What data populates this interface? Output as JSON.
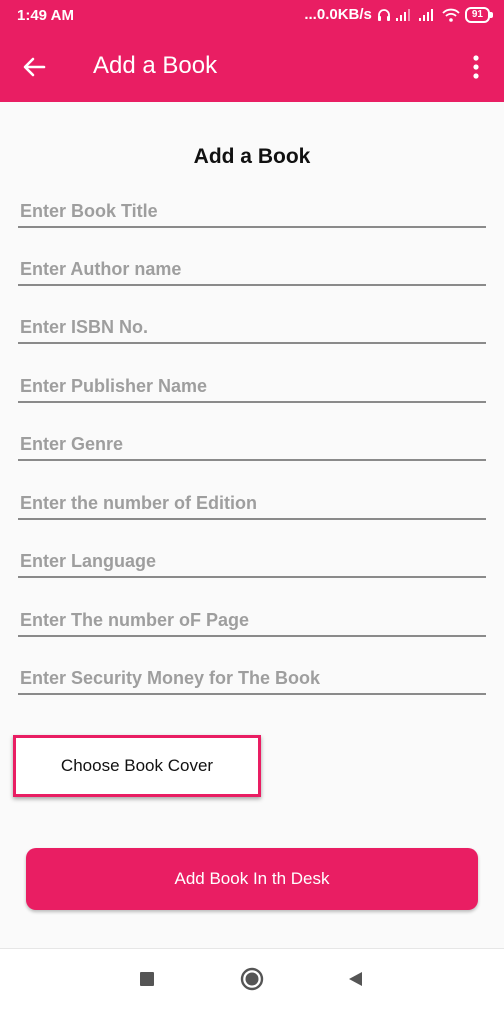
{
  "status_bar": {
    "time": "1:49 AM",
    "network_speed": "...0.0KB/s",
    "battery": "91",
    "icons": [
      "headphones-icon",
      "signal-icon",
      "signal-icon",
      "wifi-icon",
      "battery-icon"
    ]
  },
  "app_bar": {
    "title": "Add a Book",
    "back_icon": "arrow-back-icon",
    "menu_icon": "more-vert-icon"
  },
  "form": {
    "title": "Add a Book",
    "fields": [
      {
        "placeholder": "Enter Book Title",
        "value": ""
      },
      {
        "placeholder": "Enter Author name",
        "value": ""
      },
      {
        "placeholder": "Enter ISBN No.",
        "value": ""
      },
      {
        "placeholder": "Enter Publisher Name",
        "value": ""
      },
      {
        "placeholder": "Enter Genre",
        "value": ""
      },
      {
        "placeholder": "Enter the number of Edition",
        "value": ""
      },
      {
        "placeholder": "Enter Language",
        "value": ""
      },
      {
        "placeholder": "Enter The number oF Page",
        "value": ""
      },
      {
        "placeholder": "Enter Security Money for The Book",
        "value": ""
      }
    ],
    "choose_cover_label": "Choose Book Cover",
    "submit_label": "Add Book In th Desk"
  },
  "nav_bar": {
    "buttons": [
      "recents-square-icon",
      "home-circle-icon",
      "back-triangle-icon"
    ]
  },
  "colors": {
    "accent": "#e91e63",
    "background": "#fafafa",
    "underline": "#8a8a8a",
    "placeholder": "#9e9e9e"
  }
}
